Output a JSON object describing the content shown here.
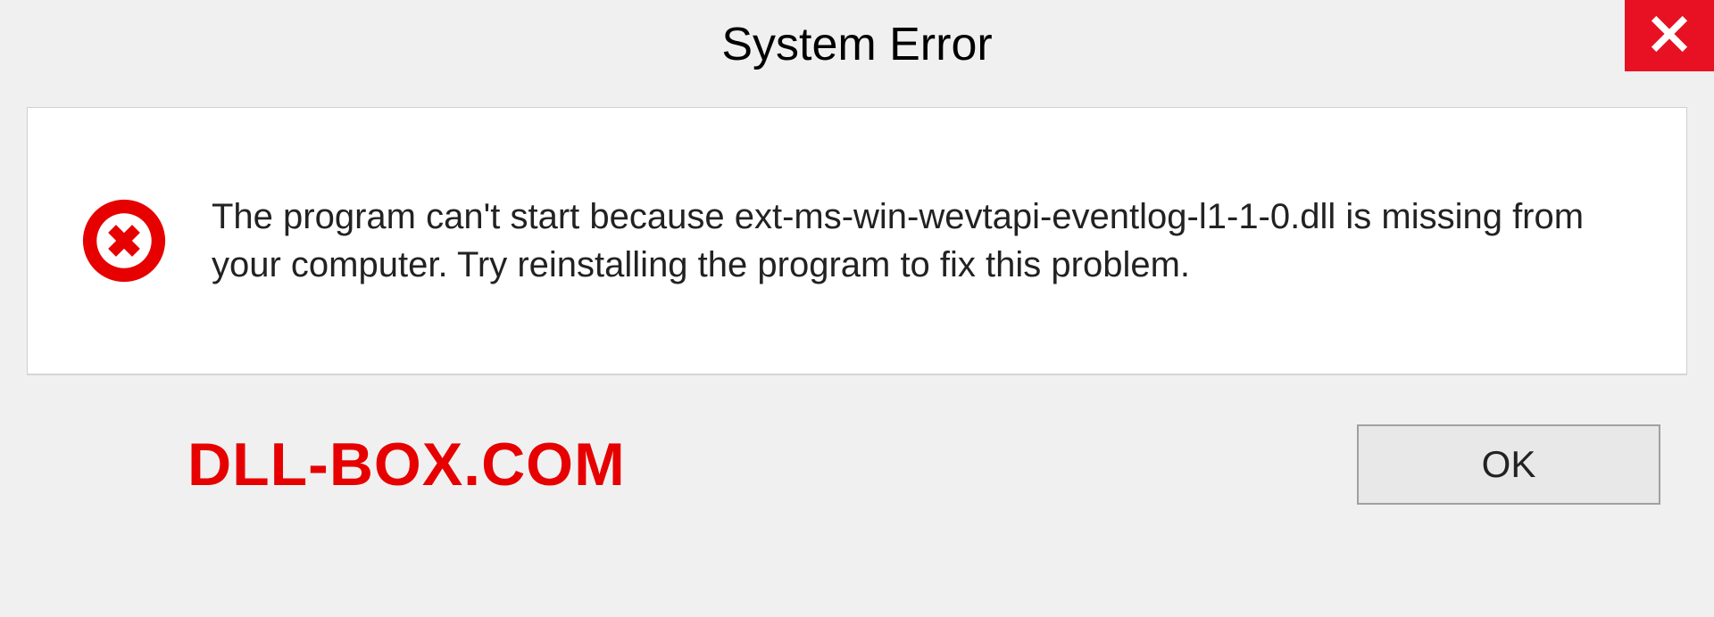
{
  "dialog": {
    "title": "System Error",
    "message": "The program can't start because ext-ms-win-wevtapi-eventlog-l1-1-0.dll is missing from your computer. Try reinstalling the program to fix this problem.",
    "ok_label": "OK"
  },
  "brand": {
    "text": "DLL-BOX.COM"
  },
  "colors": {
    "close_bg": "#e81123",
    "error_icon": "#e60000",
    "brand": "#e60000"
  }
}
